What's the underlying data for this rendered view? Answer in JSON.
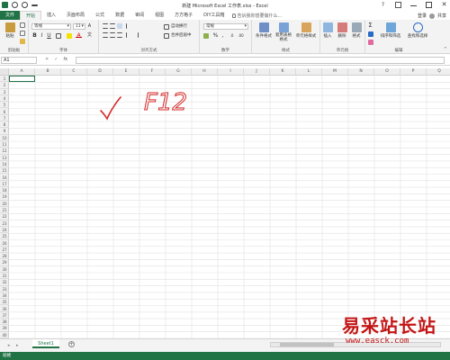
{
  "window": {
    "title": "新建 Microsoft Excel 工作表.xlsx - Excel",
    "help": "?",
    "close": "✕"
  },
  "ribbon_tabs": [
    "文件",
    "开始",
    "插入",
    "页面布局",
    "公式",
    "数据",
    "审阅",
    "视图",
    "方方格子",
    "DIY工具箱"
  ],
  "tell_me_placeholder": "告诉我你想要做什么...",
  "sign_in": "登录",
  "share": "共享",
  "clipboard": {
    "label": "剪贴板",
    "paste": "粘贴"
  },
  "font": {
    "label": "字体",
    "name": "等线",
    "size": "11",
    "bold": "B",
    "italic": "I",
    "underline": "U",
    "grow": "A",
    "wen": "文"
  },
  "alignment": {
    "label": "对齐方式",
    "wrap": "自动换行",
    "merge": "合并后居中"
  },
  "number": {
    "label": "数字",
    "format": "常规",
    "percent": "%",
    "comma": ","
  },
  "styles": {
    "label": "样式",
    "conditional": "条件格式",
    "table": "套用表格格式",
    "cell": "单元格样式"
  },
  "cells_group": {
    "label": "单元格",
    "insert": "插入",
    "delete": "删除",
    "format": "格式"
  },
  "editing": {
    "label": "编辑",
    "sum": "Σ",
    "sort": "排序和筛选",
    "find": "查找和选择"
  },
  "formula_bar": {
    "name_box": "A1",
    "fx": "fx",
    "value": ""
  },
  "columns": [
    "A",
    "B",
    "C",
    "D",
    "E",
    "F",
    "G",
    "H",
    "I",
    "J",
    "K",
    "L",
    "M",
    "N",
    "O",
    "P",
    "Q"
  ],
  "rows": [
    "1",
    "2",
    "3",
    "4",
    "5",
    "6",
    "7",
    "8",
    "9",
    "10",
    "11",
    "12",
    "13",
    "14",
    "15",
    "16",
    "17",
    "18",
    "19",
    "20",
    "21",
    "22",
    "23",
    "24",
    "25",
    "26",
    "27",
    "28",
    "29",
    "30",
    "31",
    "32",
    "33",
    "34",
    "35",
    "36",
    "37",
    "38",
    "39",
    "40"
  ],
  "handwriting": {
    "text": "F12"
  },
  "sheets": [
    "Sheet1"
  ],
  "add_sheet": "+",
  "nav_left": "◂",
  "nav_right": "▸",
  "status": "就绪",
  "watermark": {
    "text": "易采站长站",
    "url": "www.easck.com"
  }
}
